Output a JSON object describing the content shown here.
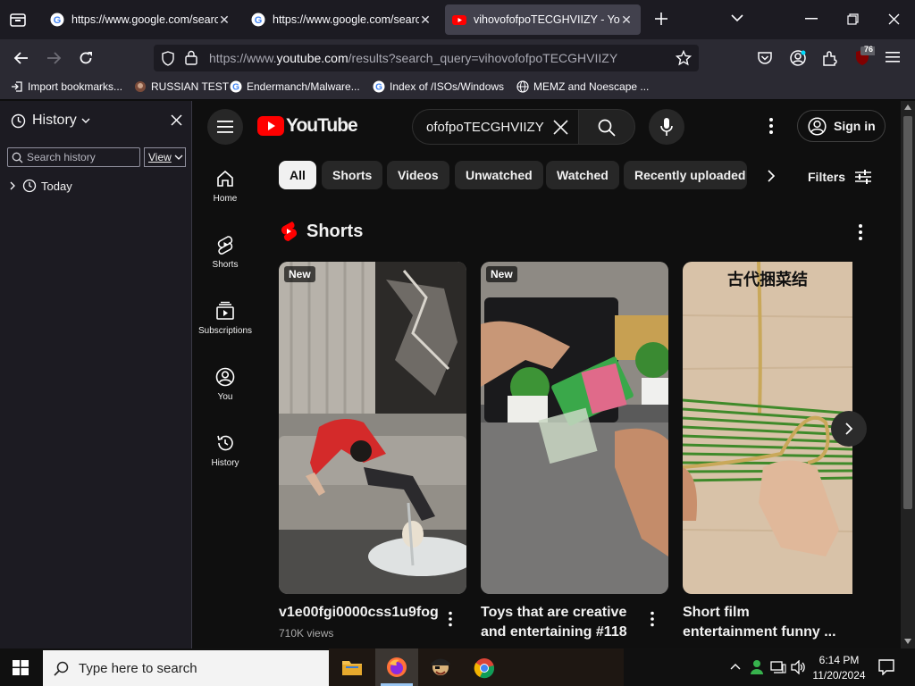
{
  "browser": {
    "tabs": [
      {
        "title": "https://www.google.com/search?",
        "active": false
      },
      {
        "title": "https://www.google.com/search?",
        "active": false
      },
      {
        "title": "vihovofofpoTECGHVIIZY - YouTube",
        "active": true
      }
    ],
    "url_prefix": "https://www.",
    "url_domain": "youtube.com",
    "url_rest": "/results?search_query=vihovofofpoTECGHVIIZY",
    "extension_badge": "76",
    "bookmarks": [
      "Import bookmarks...",
      "RUSSIAN TEST",
      "Endermanch/Malware...",
      "Index of /ISOs/Windows",
      "MEMZ and Noescape ..."
    ]
  },
  "sidebar": {
    "title": "History",
    "search_placeholder": "Search history",
    "view_label": "View",
    "groups": [
      "Today"
    ]
  },
  "youtube": {
    "logo_text": "YouTube",
    "search_value": "ofofpoTECGHVIIZY",
    "sign_in": "Sign in",
    "guide": [
      {
        "label": "Home",
        "icon": "home-icon"
      },
      {
        "label": "Shorts",
        "icon": "shorts-icon"
      },
      {
        "label": "Subscriptions",
        "icon": "subscriptions-icon"
      },
      {
        "label": "You",
        "icon": "you-icon"
      },
      {
        "label": "History",
        "icon": "history-icon"
      }
    ],
    "chips": [
      "All",
      "Shorts",
      "Videos",
      "Unwatched",
      "Watched",
      "Recently uploaded"
    ],
    "filters_label": "Filters",
    "shelf_title": "Shorts",
    "shorts": [
      {
        "badge": "New",
        "title": "v1e00fgi0000css1u9fog",
        "views": "710K views",
        "overlay": ""
      },
      {
        "badge": "New",
        "title": "Toys that are creative and entertaining #118",
        "views": "",
        "overlay": ""
      },
      {
        "badge": "",
        "title": "Short film entertainment funny ...",
        "views": "",
        "overlay": "古代捆菜结"
      }
    ],
    "colors": {
      "brand_red": "#ff0000",
      "background": "#0f0f0f",
      "chip": "#272727"
    }
  },
  "taskbar": {
    "search_placeholder": "Type here to search",
    "time": "6:14 PM",
    "date": "11/20/2024"
  }
}
